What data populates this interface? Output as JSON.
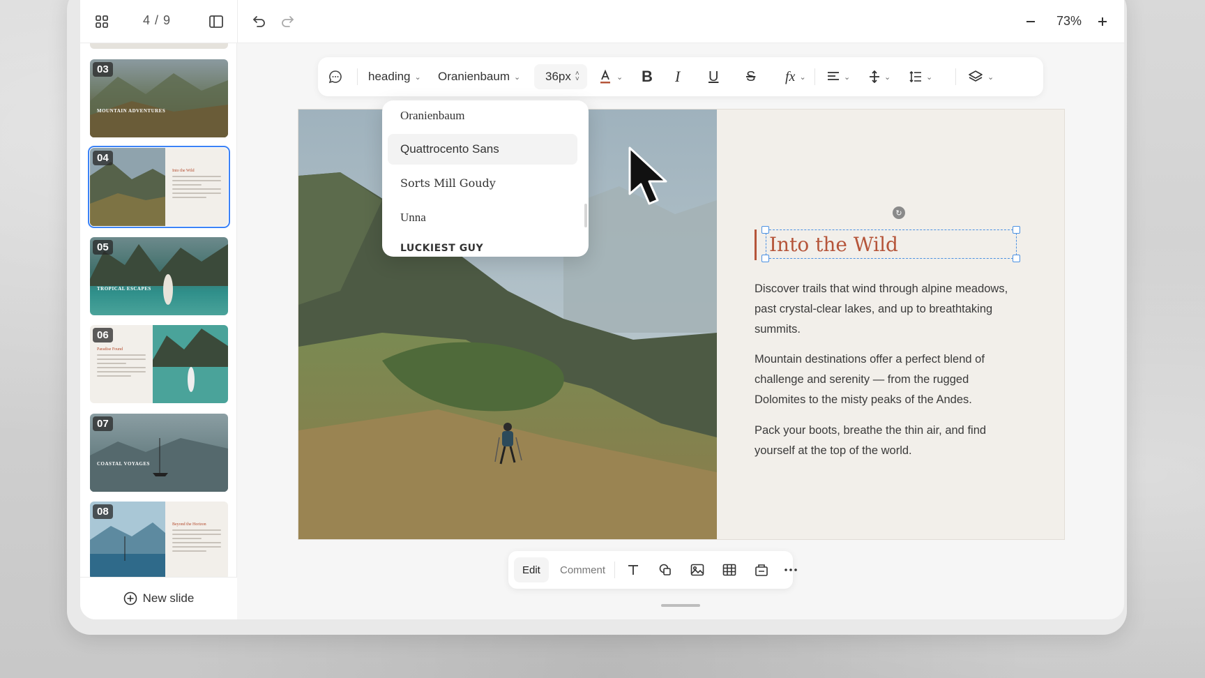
{
  "topbar": {
    "page_count": "4 / 9",
    "zoom": "73%",
    "icons": [
      "grid-icon",
      "sidebar-panel-icon",
      "undo-icon",
      "redo-icon",
      "minus-icon",
      "plus-icon"
    ]
  },
  "sidebar": {
    "thumbnails": [
      {
        "num": "03",
        "caption": "MOUNTAIN ADVENTURES"
      },
      {
        "num": "04",
        "caption": "Into the Wild"
      },
      {
        "num": "05",
        "caption": "TROPICAL ESCAPES"
      },
      {
        "num": "06",
        "caption": "Paradise Found"
      },
      {
        "num": "07",
        "caption": "COASTAL VOYAGES"
      },
      {
        "num": "08",
        "caption": "Beyond the Horizon"
      }
    ],
    "new_slide_label": "New slide"
  },
  "format_toolbar": {
    "style": "heading",
    "font": "Oranienbaum",
    "size": "36px",
    "accent_color": "#b5553a"
  },
  "font_dropdown": {
    "items": [
      "Oranienbaum",
      "Quattrocento Sans",
      "Sorts Mill Goudy",
      "Unna",
      "LUCKIEST GUY"
    ],
    "hovered": "Quattrocento Sans"
  },
  "slide": {
    "title": "Into the Wild",
    "paragraphs": [
      "Discover trails that wind through alpine meadows, past crystal-clear lakes, and up to breathtaking summits.",
      "Mountain destinations offer a perfect blend of challenge and serenity — from the rugged Dolomites to the misty peaks of the Andes.",
      "Pack your boots, breathe the thin air, and find yourself at the top of the world."
    ]
  },
  "bottom_toolbar": {
    "edit_label": "Edit",
    "comment_label": "Comment",
    "icons": [
      "text-icon",
      "shapes-icon",
      "image-icon",
      "table-icon",
      "chart-icon",
      "more-icon"
    ]
  }
}
